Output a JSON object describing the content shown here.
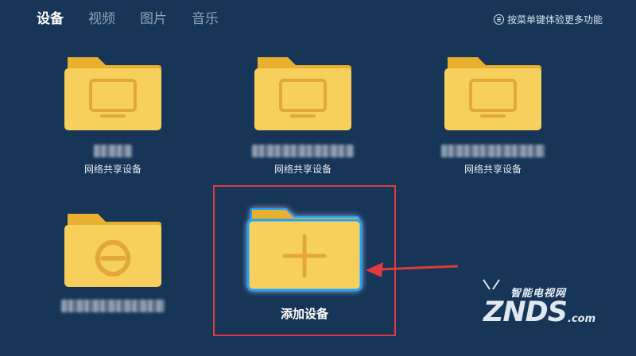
{
  "tabs": [
    {
      "label": "设备",
      "active": true
    },
    {
      "label": "视频",
      "active": false
    },
    {
      "label": "图片",
      "active": false
    },
    {
      "label": "音乐",
      "active": false
    }
  ],
  "hint": {
    "icon": "menu-icon",
    "text": "按菜单键体验更多功能"
  },
  "devices": [
    {
      "icon": "monitor-icon",
      "label": "网络共享设备",
      "name_blurred": true
    },
    {
      "icon": "monitor-icon",
      "label": "网络共享设备",
      "name_blurred": true
    },
    {
      "icon": "monitor-icon",
      "label": "网络共享设备",
      "name_blurred": true
    },
    {
      "icon": "share-link-icon",
      "label": "",
      "name_blurred": true
    }
  ],
  "add_device": {
    "icon": "plus-icon",
    "label": "添加设备"
  },
  "watermark": {
    "top": "智能电视网",
    "main": "ZNDS",
    "suffix": ".com"
  },
  "colors": {
    "background": "#173556",
    "folder": "#f7cf5d",
    "folder_tab": "#e9b02f",
    "highlight": "#e03a3e"
  }
}
